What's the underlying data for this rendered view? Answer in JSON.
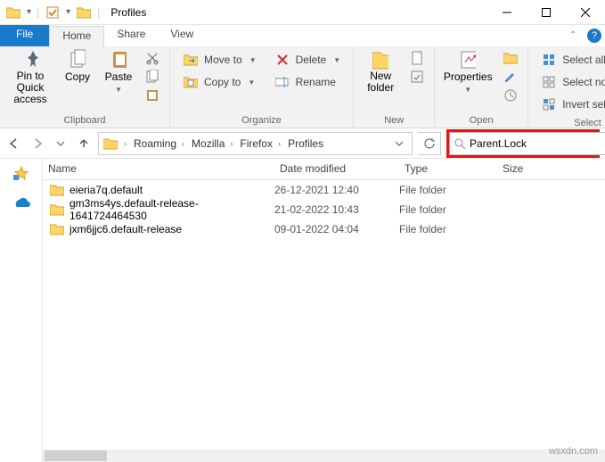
{
  "window": {
    "title": "Profiles"
  },
  "tabs": {
    "file": "File",
    "items": [
      "Home",
      "Share",
      "View"
    ],
    "active_index": 0
  },
  "ribbon": {
    "clipboard": {
      "pin": "Pin to Quick access",
      "copy": "Copy",
      "paste": "Paste",
      "group_label": "Clipboard"
    },
    "organize": {
      "moveto": "Move to",
      "copyto": "Copy to",
      "delete": "Delete",
      "rename": "Rename",
      "group_label": "Organize"
    },
    "new": {
      "newfolder": "New folder",
      "group_label": "New"
    },
    "open": {
      "properties": "Properties",
      "group_label": "Open"
    },
    "select": {
      "selectall": "Select all",
      "selectnone": "Select none",
      "invert": "Invert selection",
      "group_label": "Select"
    }
  },
  "breadcrumb": [
    "Roaming",
    "Mozilla",
    "Firefox",
    "Profiles"
  ],
  "search": {
    "value": "Parent.Lock"
  },
  "columns": {
    "name": "Name",
    "date": "Date modified",
    "type": "Type",
    "size": "Size"
  },
  "rows": [
    {
      "name": "eieria7q.default",
      "date": "26-12-2021 12:40",
      "type": "File folder"
    },
    {
      "name": "gm3ms4ys.default-release-1641724464530",
      "date": "21-02-2022 10:43",
      "type": "File folder"
    },
    {
      "name": "jxm6jjc6.default-release",
      "date": "09-01-2022 04:04",
      "type": "File folder"
    }
  ],
  "watermark": "wsxdn.com"
}
